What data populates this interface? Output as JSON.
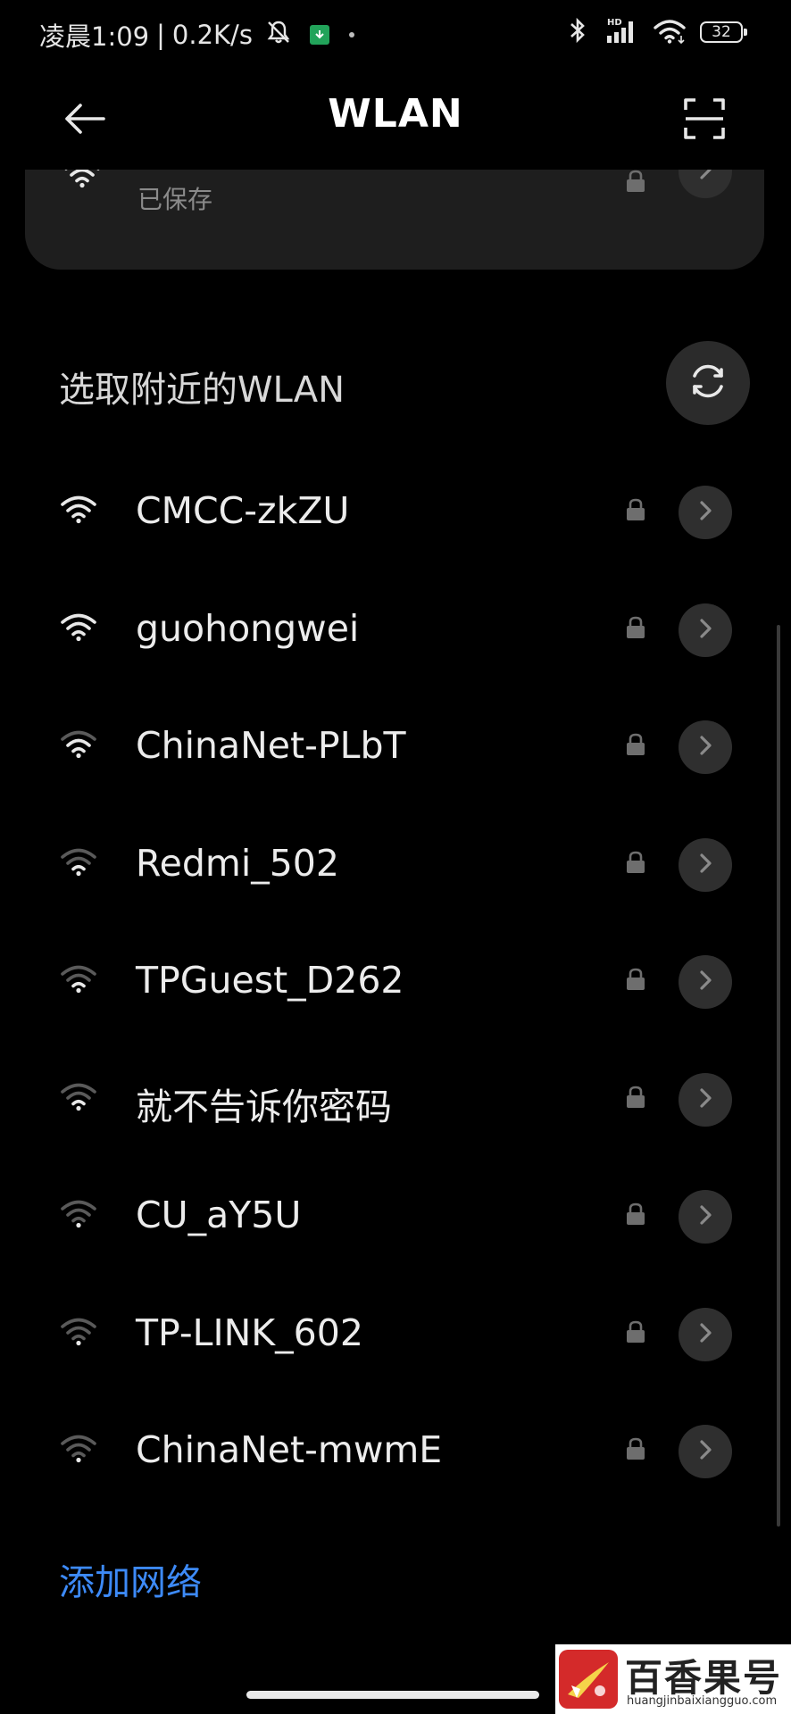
{
  "status_bar": {
    "time": "凌晨1:09",
    "separator": "|",
    "net_speed": "0.2K/s",
    "network_type": "HD",
    "battery": "32"
  },
  "header": {
    "title": "WLAN"
  },
  "saved_network": {
    "status": "已保存"
  },
  "nearby": {
    "title": "选取附近的WLAN",
    "networks": [
      {
        "ssid": "CMCC-zkZU",
        "signal": 4
      },
      {
        "ssid": "guohongwei",
        "signal": 4
      },
      {
        "ssid": "ChinaNet-PLbT",
        "signal": 3
      },
      {
        "ssid": "Redmi_502",
        "signal": 2
      },
      {
        "ssid": "TPGuest_D262",
        "signal": 2
      },
      {
        "ssid": "就不告诉你密码",
        "signal": 2
      },
      {
        "ssid": "CU_aY5U",
        "signal": 1
      },
      {
        "ssid": "TP-LINK_602",
        "signal": 1
      },
      {
        "ssid": "ChinaNet-mwmE",
        "signal": 1
      }
    ]
  },
  "add_network": "添加网络",
  "watermark": {
    "title": "百香果号",
    "url": "huangjinbaixiangguo.com"
  },
  "colors": {
    "background": "#000000",
    "card": "#1e1e1e",
    "accent": "#3d8af7",
    "button_bg": "#2f2f2f"
  },
  "icons": {
    "back": "arrow-left-icon",
    "scan": "qr-scan-icon",
    "refresh": "refresh-icon",
    "wifi": "wifi-icon",
    "lock": "lock-icon",
    "chevron": "chevron-right-icon"
  }
}
